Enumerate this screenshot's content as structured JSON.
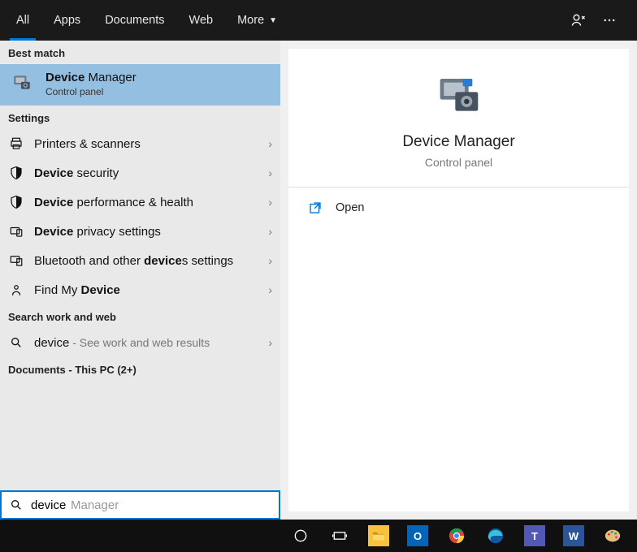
{
  "tabs": {
    "items": [
      {
        "label": "All",
        "active": true
      },
      {
        "label": "Apps",
        "active": false
      },
      {
        "label": "Documents",
        "active": false
      },
      {
        "label": "Web",
        "active": false
      },
      {
        "label": "More",
        "active": false,
        "dropdown": true
      }
    ]
  },
  "sections": {
    "best_match_header": "Best match",
    "settings_header": "Settings",
    "webwork_header": "Search work and web",
    "documents_header": "Documents - This PC (2+)"
  },
  "best_match": {
    "title_bold": "Device",
    "title_rest": " Manager",
    "subtitle": "Control panel"
  },
  "settings_items": [
    {
      "icon": "printer",
      "label": "Printers & scanners"
    },
    {
      "icon": "shield",
      "bold": "Device",
      "rest": " security"
    },
    {
      "icon": "shield",
      "bold": "Device",
      "rest": " performance & health"
    },
    {
      "icon": "privacy",
      "bold": "Device",
      "rest": " privacy settings"
    },
    {
      "icon": "bluetooth",
      "label": "Bluetooth and other ",
      "bold2": "device",
      "rest2": "s settings"
    },
    {
      "icon": "findmy",
      "label": "Find My ",
      "bold2": "Device"
    }
  ],
  "web_item": {
    "icon": "search",
    "term": "device",
    "hint": " - See work and web results"
  },
  "preview": {
    "title": "Device Manager",
    "subtitle": "Control panel",
    "action_label": "Open"
  },
  "search": {
    "typed": "device",
    "ghost": "Manager"
  },
  "taskbar": {
    "items": [
      {
        "name": "cortana",
        "kind": "ring"
      },
      {
        "name": "taskview",
        "kind": "taskview"
      },
      {
        "name": "explorer",
        "bg": "#f8c23a",
        "txt": "",
        "kind": "folder"
      },
      {
        "name": "outlook",
        "bg": "#0364b8",
        "txt": "O",
        "kind": "tile"
      },
      {
        "name": "chrome",
        "kind": "chrome"
      },
      {
        "name": "edge",
        "kind": "edge"
      },
      {
        "name": "teams",
        "bg": "#5258b6",
        "txt": "T",
        "kind": "tile"
      },
      {
        "name": "word",
        "bg": "#2a5699",
        "txt": "W",
        "kind": "tile"
      },
      {
        "name": "paint",
        "kind": "paint"
      }
    ]
  }
}
